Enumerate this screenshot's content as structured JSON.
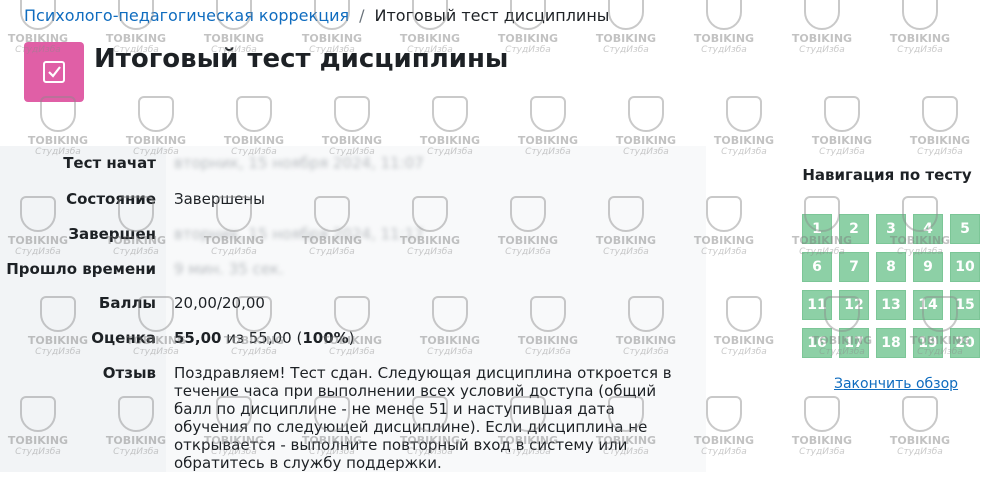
{
  "breadcrumb": {
    "parent": "Психолого-педагогическая коррекция",
    "separator": "/",
    "current": "Итоговый тест дисциплины"
  },
  "page": {
    "title": "Итоговый тест дисциплины",
    "icon": "quiz-check-icon",
    "icon_color": "#e05fa6"
  },
  "summary": {
    "started_label": "Тест начат",
    "started_value": "вторник, 15 ноября 2024, 11:07",
    "state_label": "Состояние",
    "state_value": "Завершены",
    "completed_label": "Завершен",
    "completed_value": "вторник, 15 ноября 2024, 11:17",
    "duration_label": "Прошло времени",
    "duration_value": "9 мин. 35 сек.",
    "marks_label": "Баллы",
    "marks_value": "20,00/20,00",
    "grade_label": "Оценка",
    "grade_score": "55,00",
    "grade_of": "из",
    "grade_max": "55,00",
    "grade_percent": "100%",
    "feedback_label": "Отзыв",
    "feedback_text": "Поздравляем! Тест сдан. Следующая дисциплина откроется в течение часа при выполнении всех условий доступа (общий балл по дисциплине - не менее 51 и наступившая дата обучения по следующей дисциплине). Если дисциплина не открывается - выполните повторный вход в систему или обратитесь в службу поддержки."
  },
  "navigation": {
    "title": "Навигация по тесту",
    "buttons": [
      "1",
      "2",
      "3",
      "4",
      "5",
      "6",
      "7",
      "8",
      "9",
      "10",
      "11",
      "12",
      "13",
      "14",
      "15",
      "16",
      "17",
      "18",
      "19",
      "20"
    ],
    "finish_label": "Закончить обзор",
    "button_color": "#8dd0a6"
  },
  "watermark": {
    "brand": "TOBIKING",
    "sub": "СтудИзба"
  }
}
